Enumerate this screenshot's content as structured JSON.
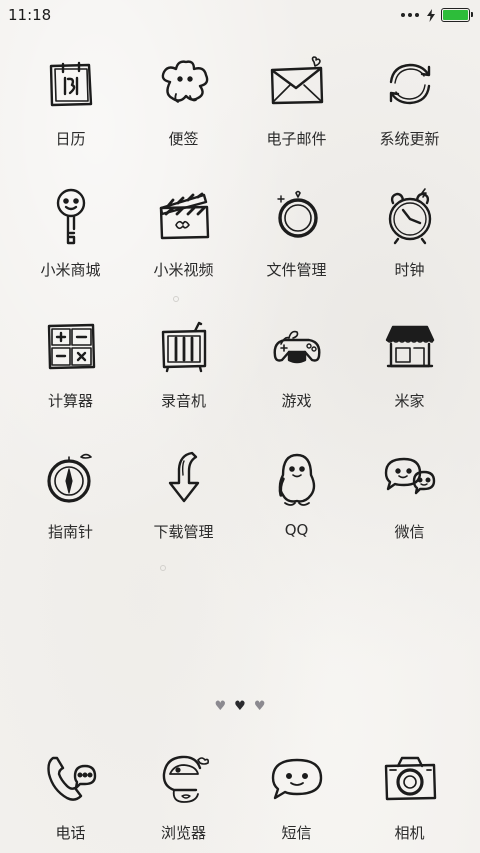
{
  "status_bar": {
    "time": "11:18",
    "charging_icon": "charging-bolt-icon",
    "battery_level": 1.0,
    "battery_color": "#2dbd3a"
  },
  "apps": [
    {
      "label": "日历",
      "icon": "calendar-icon"
    },
    {
      "label": "便签",
      "icon": "notes-icon"
    },
    {
      "label": "电子邮件",
      "icon": "mail-icon"
    },
    {
      "label": "系统更新",
      "icon": "update-icon"
    },
    {
      "label": "小米商城",
      "icon": "mi-store-icon"
    },
    {
      "label": "小米视频",
      "icon": "video-icon"
    },
    {
      "label": "文件管理",
      "icon": "file-manager-icon"
    },
    {
      "label": "时钟",
      "icon": "clock-icon"
    },
    {
      "label": "计算器",
      "icon": "calculator-icon"
    },
    {
      "label": "录音机",
      "icon": "recorder-icon"
    },
    {
      "label": "游戏",
      "icon": "game-icon"
    },
    {
      "label": "米家",
      "icon": "mijia-icon"
    },
    {
      "label": "指南针",
      "icon": "compass-icon"
    },
    {
      "label": "下载管理",
      "icon": "download-icon"
    },
    {
      "label": "QQ",
      "icon": "qq-icon"
    },
    {
      "label": "微信",
      "icon": "wechat-icon"
    }
  ],
  "pager": {
    "pages": 3,
    "current": 2,
    "glyph": "♥",
    "active_color": "#2a2a2e",
    "inactive_color": "#8c8a90"
  },
  "dock": [
    {
      "label": "电话",
      "icon": "phone-icon"
    },
    {
      "label": "浏览器",
      "icon": "browser-icon"
    },
    {
      "label": "短信",
      "icon": "messages-icon"
    },
    {
      "label": "相机",
      "icon": "camera-icon"
    }
  ]
}
